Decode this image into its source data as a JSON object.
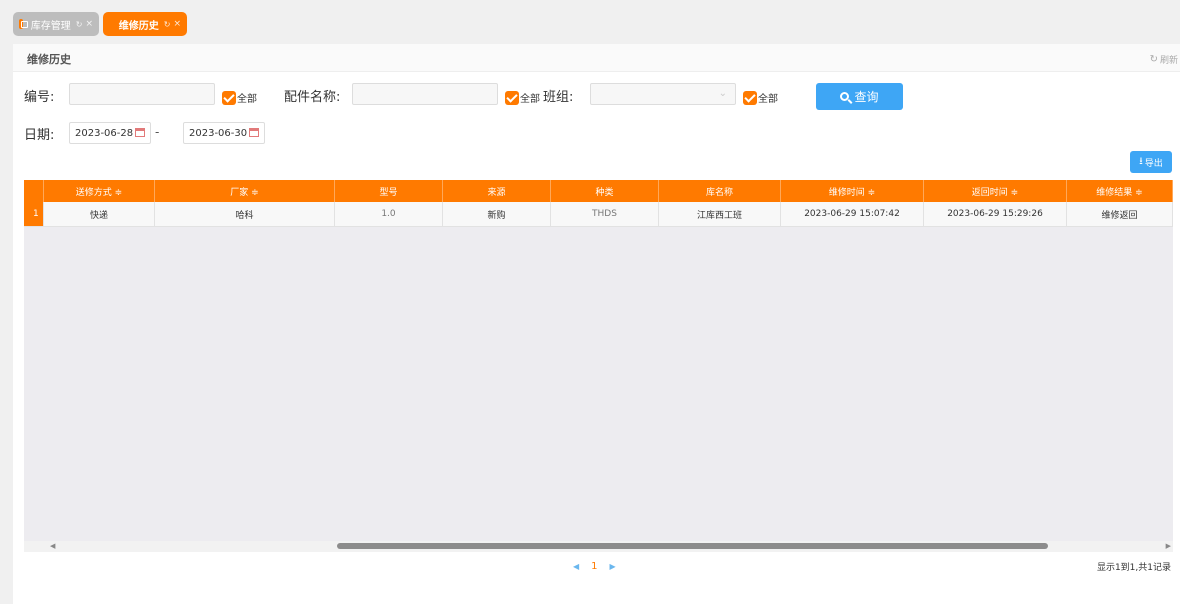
{
  "tabs": [
    {
      "label": "库存管理",
      "ctrl": "↻",
      "close": "×"
    },
    {
      "label": "维修历史",
      "ctrl": "↻",
      "close": "×"
    }
  ],
  "panel": {
    "title": "维修历史",
    "refresh_label": "刷新"
  },
  "filters": {
    "code_label": "编号:",
    "code_value": "",
    "part_label": "配件名称:",
    "part_value": "",
    "team_label": "班组:",
    "team_value": "",
    "all_label": "全部",
    "date_label": "日期:",
    "date_from": "2023-06-28",
    "date_sep": "-",
    "date_to": "2023-06-30",
    "query_label": "查询"
  },
  "export_label": "导出",
  "table": {
    "columns": [
      "送修方式 ≑",
      "厂家 ≑",
      "型号",
      "来源",
      "种类",
      "库名称",
      "维修时间 ≑",
      "返回时间 ≑",
      "维修结果 ≑"
    ],
    "rows": [
      {
        "num": "1",
        "cells": [
          "快递",
          "哈科",
          "1.0",
          "新购",
          "THDS",
          "江库西工班",
          "2023-06-29 15:07:42",
          "2023-06-29 15:29:26",
          "维修返回"
        ]
      }
    ]
  },
  "scroll": {
    "left_arrow": "◀",
    "right_arrow": "▶"
  },
  "pagination": {
    "prev": "◀",
    "page": "1",
    "next": "▶",
    "summary": "显示1到1,共1记录"
  },
  "colors": {
    "accent": "#ff7a00",
    "primary": "#3ea6f5"
  }
}
